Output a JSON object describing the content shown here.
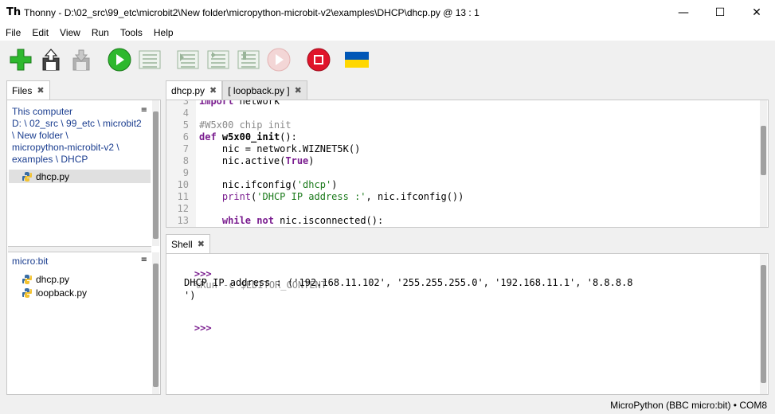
{
  "window": {
    "title": "Thonny  -  D:\\02_src\\99_etc\\microbit2\\New folder\\micropython-microbit-v2\\examples\\DHCP\\dhcp.py  @  13 : 1",
    "minimize": "—",
    "maximize": "☐",
    "close": "✕"
  },
  "menu": [
    "File",
    "Edit",
    "View",
    "Run",
    "Tools",
    "Help"
  ],
  "toolbar": {
    "icons": [
      "new-file",
      "load",
      "save",
      "run",
      "debug",
      "step-over",
      "step-into",
      "step-out",
      "resume",
      "stop",
      "ukraine-flag"
    ],
    "colors": {
      "green": "#2eb82e",
      "red": "#e0142a",
      "flag_blue": "#0057b7",
      "flag_yellow": "#ffd700"
    }
  },
  "files_tab": {
    "label": "Files",
    "close": "✖"
  },
  "files": {
    "this_computer": {
      "title": "This computer",
      "menu_glyph": "≡",
      "path_lines": [
        "D: \\ 02_src \\ 99_etc \\ microbit2",
        "\\ New folder \\",
        "micropython-microbit-v2 \\",
        "examples \\ DHCP"
      ],
      "items": [
        "dhcp.py"
      ]
    },
    "microbit": {
      "title": "micro:bit",
      "menu_glyph": "≡",
      "items": [
        "dhcp.py",
        "loopback.py"
      ]
    }
  },
  "editor": {
    "tabs": [
      {
        "label": "dhcp.py",
        "active": true
      },
      {
        "label": "[ loopback.py ]",
        "active": false
      }
    ],
    "close": "✖",
    "lines": [
      {
        "n": "3",
        "text": "import network"
      },
      {
        "n": "4",
        "text": ""
      },
      {
        "n": "5",
        "text": "#W5x00 chip init"
      },
      {
        "n": "6",
        "text": "def w5x00_init():"
      },
      {
        "n": "7",
        "text": "    nic = network.WIZNET5K()"
      },
      {
        "n": "8",
        "text": "    nic.active(True)"
      },
      {
        "n": "9",
        "text": ""
      },
      {
        "n": "10",
        "text": "    nic.ifconfig('dhcp')"
      },
      {
        "n": "11",
        "text": "    print('DHCP IP address :', nic.ifconfig())"
      },
      {
        "n": "12",
        "text": ""
      },
      {
        "n": "13",
        "text": "    while not nic.isconnected():"
      }
    ]
  },
  "shell": {
    "tab": "Shell",
    "close": "✖",
    "prompt": ">>>",
    "command": "%Run -c $EDITOR_CONTENT",
    "output_1": "DHCP IP address : ('192.168.11.102', '255.255.255.0', '192.168.11.1', '8.8.8.8",
    "output_2": "')",
    "prompt2": ">>>"
  },
  "status": {
    "interpreter": "MicroPython (BBC micro:bit)  •  COM8"
  }
}
